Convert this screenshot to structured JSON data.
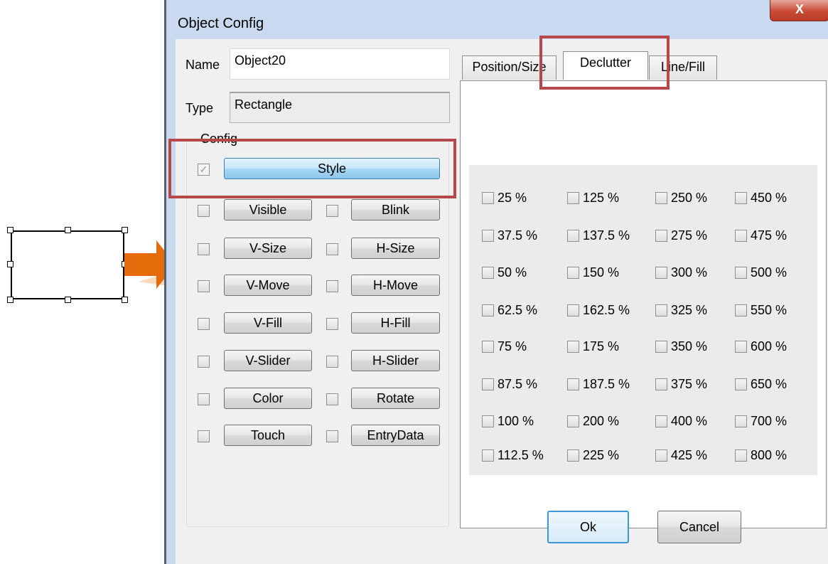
{
  "window": {
    "title": "Object Config",
    "close_label": "X"
  },
  "fields": {
    "name_label": "Name",
    "name_value": "Object20",
    "type_label": "Type",
    "type_value": "Rectangle"
  },
  "config": {
    "title": "Config",
    "style": {
      "label": "Style",
      "checked": true
    },
    "rows": [
      {
        "left": "Visible",
        "right": "Blink"
      },
      {
        "left": "V-Size",
        "right": "H-Size"
      },
      {
        "left": "V-Move",
        "right": "H-Move"
      },
      {
        "left": "V-Fill",
        "right": "H-Fill"
      },
      {
        "left": "V-Slider",
        "right": "H-Slider"
      },
      {
        "left": "Color",
        "right": "Rotate"
      },
      {
        "left": "Touch",
        "right": "EntryData"
      }
    ]
  },
  "tabs": [
    {
      "label": "Position/Size",
      "active": false
    },
    {
      "label": "Declutter",
      "active": true
    },
    {
      "label": "Line/Fill",
      "active": false
    }
  ],
  "declutter": {
    "columns": [
      [
        "25 %",
        "37.5 %",
        "50 %",
        "62.5 %",
        "75 %",
        "87.5 %",
        "100 %",
        "112.5 %"
      ],
      [
        "125 %",
        "137.5 %",
        "150 %",
        "162.5 %",
        "175 %",
        "187.5 %",
        "200 %",
        "225 %"
      ],
      [
        "250 %",
        "275 %",
        "300 %",
        "325 %",
        "350 %",
        "375 %",
        "400 %",
        "425 %"
      ],
      [
        "450 %",
        "475 %",
        "500 %",
        "550 %",
        "600 %",
        "650 %",
        "700 %",
        "800 %"
      ]
    ]
  },
  "footer": {
    "ok_label": "Ok",
    "cancel_label": "Cancel"
  },
  "colors": {
    "highlight": "#b7484a",
    "arrow": "#e46c0a"
  }
}
